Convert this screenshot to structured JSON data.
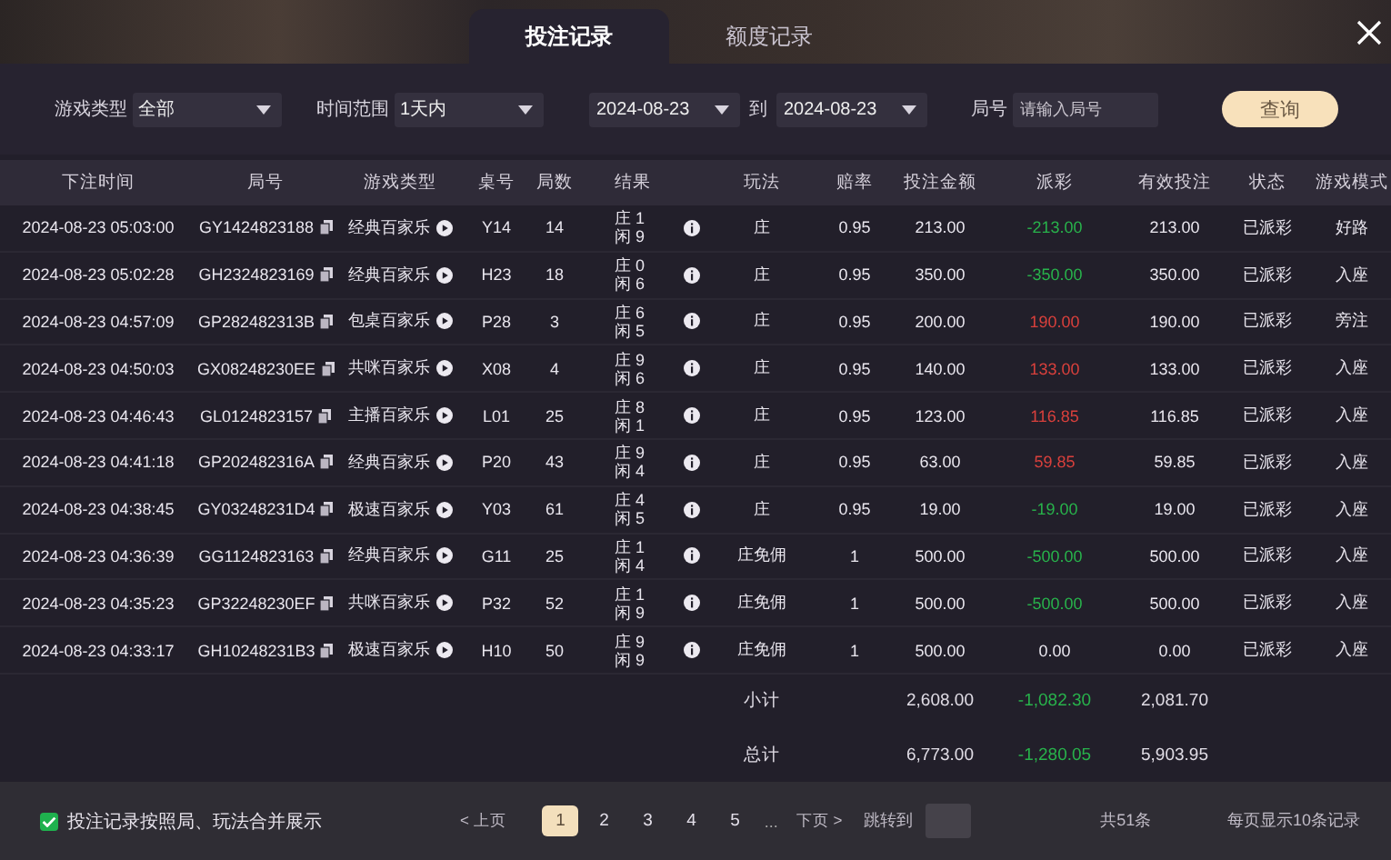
{
  "tabs": [
    {
      "label": "投注记录",
      "selected": true
    },
    {
      "label": "额度记录",
      "selected": false
    }
  ],
  "filters": {
    "game_type": {
      "label": "游戏类型",
      "value": "全部"
    },
    "time_range": {
      "label": "时间范围",
      "value": "1天内"
    },
    "date_from": "2024-08-23",
    "date_separator": "到",
    "date_to": "2024-08-23",
    "round": {
      "label": "局号",
      "placeholder": "请输入局号"
    },
    "search_button": "查询"
  },
  "table": {
    "columns": [
      "下注时间",
      "局号",
      "游戏类型",
      "桌号",
      "局数",
      "结果",
      "玩法",
      "赔率",
      "投注金额",
      "派彩",
      "有效投注",
      "状态",
      "游戏模式"
    ],
    "rows": [
      {
        "time": "2024-08-23 05:03:00",
        "round_id": "GY1424823188",
        "game_type": "经典百家乐",
        "table": "Y14",
        "rounds": "14",
        "result": [
          "庄 1",
          "闲 9"
        ],
        "play": "庄",
        "odds": "0.95",
        "bet": "213.00",
        "payout": {
          "text": "-213.00",
          "color": "#28b24b"
        },
        "valid_bet": "213.00",
        "status": "已派彩",
        "mode": "好路"
      },
      {
        "time": "2024-08-23 05:02:28",
        "round_id": "GH2324823169",
        "game_type": "经典百家乐",
        "table": "H23",
        "rounds": "18",
        "result": [
          "庄 0",
          "闲 6"
        ],
        "play": "庄",
        "odds": "0.95",
        "bet": "350.00",
        "payout": {
          "text": "-350.00",
          "color": "#28b24b"
        },
        "valid_bet": "350.00",
        "status": "已派彩",
        "mode": "入座"
      },
      {
        "time": "2024-08-23 04:57:09",
        "round_id": "GP282482313B",
        "game_type": "包桌百家乐",
        "table": "P28",
        "rounds": "3",
        "result": [
          "庄 6",
          "闲 5"
        ],
        "play": "庄",
        "odds": "0.95",
        "bet": "200.00",
        "payout": {
          "text": "190.00",
          "color": "#d9403c"
        },
        "valid_bet": "190.00",
        "status": "已派彩",
        "mode": "旁注"
      },
      {
        "time": "2024-08-23 04:50:03",
        "round_id": "GX08248230EE",
        "game_type": "共咪百家乐",
        "table": "X08",
        "rounds": "4",
        "result": [
          "庄 9",
          "闲 6"
        ],
        "play": "庄",
        "odds": "0.95",
        "bet": "140.00",
        "payout": {
          "text": "133.00",
          "color": "#d9403c"
        },
        "valid_bet": "133.00",
        "status": "已派彩",
        "mode": "入座"
      },
      {
        "time": "2024-08-23 04:46:43",
        "round_id": "GL0124823157",
        "game_type": "主播百家乐",
        "table": "L01",
        "rounds": "25",
        "result": [
          "庄 8",
          "闲 1"
        ],
        "play": "庄",
        "odds": "0.95",
        "bet": "123.00",
        "payout": {
          "text": "116.85",
          "color": "#d9403c"
        },
        "valid_bet": "116.85",
        "status": "已派彩",
        "mode": "入座"
      },
      {
        "time": "2024-08-23 04:41:18",
        "round_id": "GP202482316A",
        "game_type": "经典百家乐",
        "table": "P20",
        "rounds": "43",
        "result": [
          "庄 9",
          "闲 4"
        ],
        "play": "庄",
        "odds": "0.95",
        "bet": "63.00",
        "payout": {
          "text": "59.85",
          "color": "#d9403c"
        },
        "valid_bet": "59.85",
        "status": "已派彩",
        "mode": "入座"
      },
      {
        "time": "2024-08-23 04:38:45",
        "round_id": "GY03248231D4",
        "game_type": "极速百家乐",
        "table": "Y03",
        "rounds": "61",
        "result": [
          "庄 4",
          "闲 5"
        ],
        "play": "庄",
        "odds": "0.95",
        "bet": "19.00",
        "payout": {
          "text": "-19.00",
          "color": "#28b24b"
        },
        "valid_bet": "19.00",
        "status": "已派彩",
        "mode": "入座"
      },
      {
        "time": "2024-08-23 04:36:39",
        "round_id": "GG1124823163",
        "game_type": "经典百家乐",
        "table": "G11",
        "rounds": "25",
        "result": [
          "庄 1",
          "闲 4"
        ],
        "play": "庄免佣",
        "odds": "1",
        "bet": "500.00",
        "payout": {
          "text": "-500.00",
          "color": "#28b24b"
        },
        "valid_bet": "500.00",
        "status": "已派彩",
        "mode": "入座"
      },
      {
        "time": "2024-08-23 04:35:23",
        "round_id": "GP32248230EF",
        "game_type": "共咪百家乐",
        "table": "P32",
        "rounds": "52",
        "result": [
          "庄 1",
          "闲 9"
        ],
        "play": "庄免佣",
        "odds": "1",
        "bet": "500.00",
        "payout": {
          "text": "-500.00",
          "color": "#28b24b"
        },
        "valid_bet": "500.00",
        "status": "已派彩",
        "mode": "入座"
      },
      {
        "time": "2024-08-23 04:33:17",
        "round_id": "GH10248231B3",
        "game_type": "极速百家乐",
        "table": "H10",
        "rounds": "50",
        "result": [
          "庄 9",
          "闲 9"
        ],
        "play": "庄免佣",
        "odds": "1",
        "bet": "500.00",
        "payout": {
          "text": "0.00",
          "color": "#e9e6ee"
        },
        "valid_bet": "0.00",
        "status": "已派彩",
        "mode": "入座"
      }
    ],
    "totals": [
      {
        "label": "小计",
        "bet": "2,608.00",
        "payout": {
          "text": "-1,082.30",
          "color": "#28b24b"
        },
        "valid_bet": "2,081.70"
      },
      {
        "label": "总计",
        "bet": "6,773.00",
        "payout": {
          "text": "-1,280.05",
          "color": "#28b24b"
        },
        "valid_bet": "5,903.95"
      }
    ]
  },
  "footer": {
    "merge_option": {
      "label": "投注记录按照局、玩法合并展示",
      "checked": true
    },
    "pagination": {
      "prev": "< 上页",
      "pages": [
        {
          "label": "1",
          "selected": true
        },
        {
          "label": "2",
          "selected": false
        },
        {
          "label": "3",
          "selected": false
        },
        {
          "label": "4",
          "selected": false
        },
        {
          "label": "5",
          "selected": false
        }
      ],
      "ellipsis": "...",
      "next": "下页 >",
      "jump_label": "跳转到"
    },
    "total_count": "共51条",
    "page_size": "每页显示10条记录"
  }
}
